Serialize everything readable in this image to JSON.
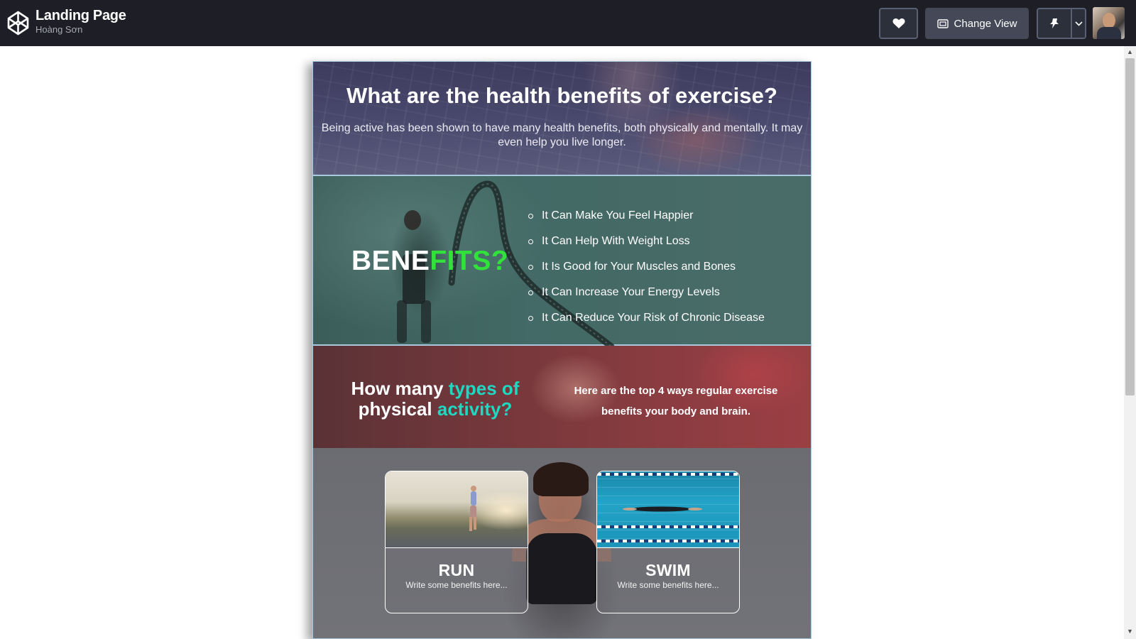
{
  "app": {
    "title": "Landing Page",
    "author": "Hoàng Sơn",
    "change_view_label": "Change View",
    "icons": [
      "codepen-logo-icon",
      "heart-icon",
      "change-view-icon",
      "pin-icon",
      "chevron-down-icon",
      "avatar"
    ]
  },
  "landing": {
    "hero": {
      "heading": "What are the health benefits of exercise?",
      "text": "Being active has been shown to have many health benefits, both physically and mentally. It may even help you live longer."
    },
    "benefits": {
      "heading_white": "BENE",
      "heading_accent": "FITS?",
      "accent_color": "#31e23a",
      "items": [
        "It Can Make You Feel Happier",
        "It Can Help With Weight Loss",
        "It Is Good for Your Muscles and Bones",
        "It Can Increase Your Energy Levels",
        "It Can Reduce Your Risk of Chronic Disease"
      ]
    },
    "types": {
      "q_part1": "How many ",
      "q_accent1": "types of",
      "q_part2": "physical ",
      "q_accent2": "activity?",
      "accent_color": "#1ed8c2",
      "answer": "Here are the top 4 ways regular exercise benefits your body and brain."
    },
    "cards": [
      {
        "name": "RUN",
        "desc": "Write some benefits here..."
      },
      {
        "name": "SWIM",
        "desc": "Write some benefits here..."
      }
    ]
  },
  "colors": {
    "topbar": "#1e1f26",
    "button": "#444857",
    "frame_border": "#a9c9dd"
  }
}
